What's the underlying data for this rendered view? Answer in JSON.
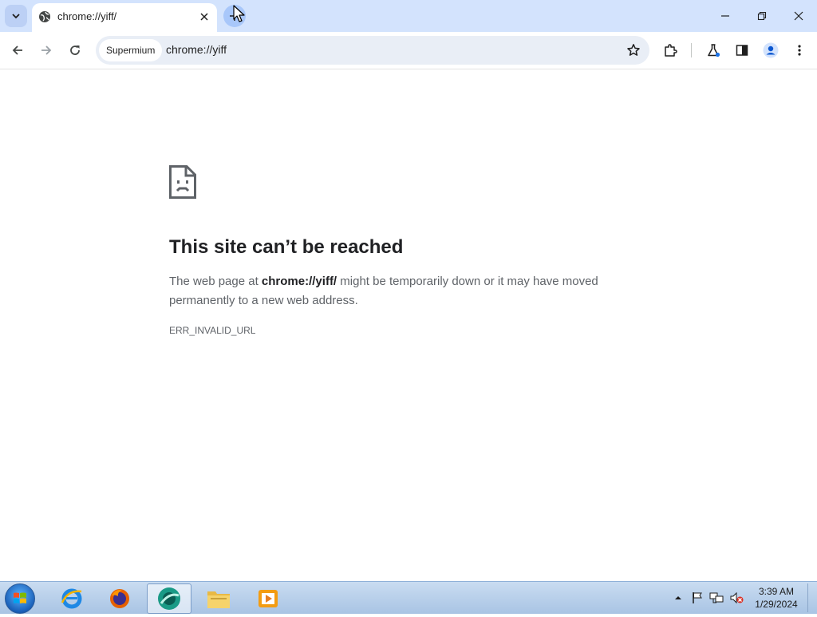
{
  "browser": {
    "tab": {
      "title": "chrome://yiff/"
    },
    "omnibox": {
      "chip_label": "Supermium",
      "url": "chrome://yiff"
    }
  },
  "error_page": {
    "heading": "This site can’t be reached",
    "description_prefix": "The web page at ",
    "url_bold": "chrome://yiff/",
    "description_suffix": " might be temporarily down or it may have moved permanently to a new web address.",
    "error_code": "ERR_INVALID_URL"
  },
  "taskbar": {
    "apps": [
      "internet-explorer",
      "firefox",
      "supermium",
      "file-explorer",
      "media-player"
    ],
    "active_app": "supermium",
    "clock": {
      "time": "3:39 AM",
      "date": "1/29/2024"
    }
  },
  "colors": {
    "tabstrip": "#d3e3fd",
    "omnibox": "#e9eef6",
    "heading": "#202124",
    "body_text": "#5f6368"
  }
}
